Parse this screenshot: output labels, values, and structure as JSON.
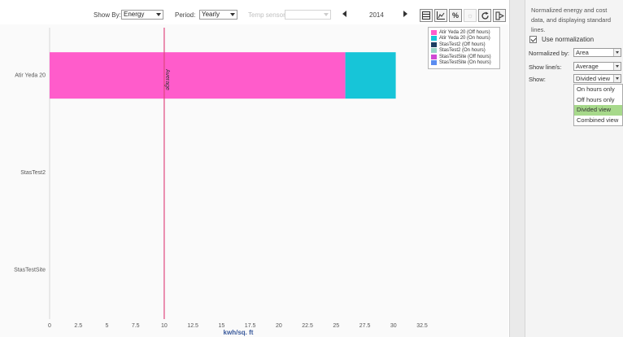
{
  "toolbar": {
    "show_by_label": "Show By:",
    "show_by_value": "Energy",
    "period_label": "Period:",
    "period_value": "Yearly",
    "temp_sensor_label": "Temp sensor:",
    "temp_sensor_value": "",
    "year": "2014",
    "icons": [
      "table-icon",
      "line-chart-icon",
      "percent-icon",
      "sun-icon",
      "refresh-icon",
      "export-icon"
    ],
    "percent_glyph": "%"
  },
  "legend": {
    "items": [
      {
        "label": "Atir Yeda 20 (Off hours)",
        "color": "#ff5ccb"
      },
      {
        "label": "Atir Yeda 20 (On hours)",
        "color": "#17c5d8"
      },
      {
        "label": "StasTest2 (Off hours)",
        "color": "#1d3f63"
      },
      {
        "label": "StasTest2 (On hours)",
        "color": "#9ad6c7"
      },
      {
        "label": "StasTestSite (Off hours)",
        "color": "#d04ad4"
      },
      {
        "label": "StasTestSite (On hours)",
        "color": "#5b8cf0"
      }
    ]
  },
  "chart_data": {
    "type": "bar",
    "orientation": "horizontal",
    "stacked": true,
    "categories": [
      "Atir Yeda 20",
      "StasTest2",
      "StasTestSite"
    ],
    "series": [
      {
        "name": "Atir Yeda 20 (Off hours)",
        "values": [
          25.8,
          0,
          0
        ],
        "color": "#ff5ccb"
      },
      {
        "name": "Atir Yeda 20 (On hours)",
        "values": [
          4.4,
          0,
          0
        ],
        "color": "#17c5d8"
      }
    ],
    "average": {
      "label": "Average",
      "value": 10,
      "color": "#e0457e"
    },
    "xlabel": "kwh/sq. ft",
    "xlim": [
      0,
      32.5
    ],
    "xticks": [
      "0",
      "2.5",
      "5",
      "7.5",
      "10",
      "12.5",
      "15",
      "17.5",
      "20",
      "22.5",
      "25",
      "27.5",
      "30",
      "32.5"
    ]
  },
  "panel": {
    "description": "Normalized energy and cost data, and displaying standard lines.",
    "use_normalization_label": "Use normalization",
    "use_normalization_checked": true,
    "normalized_by_label": "Normalized by:",
    "normalized_by_value": "Area",
    "show_lines_label": "Show line/s:",
    "show_lines_value": "Average",
    "show_label": "Show:",
    "show_value": "Divided view",
    "show_options": [
      "On hours only",
      "Off hours only",
      "Divided view",
      "Combined view"
    ],
    "show_selected": "Divided view"
  }
}
